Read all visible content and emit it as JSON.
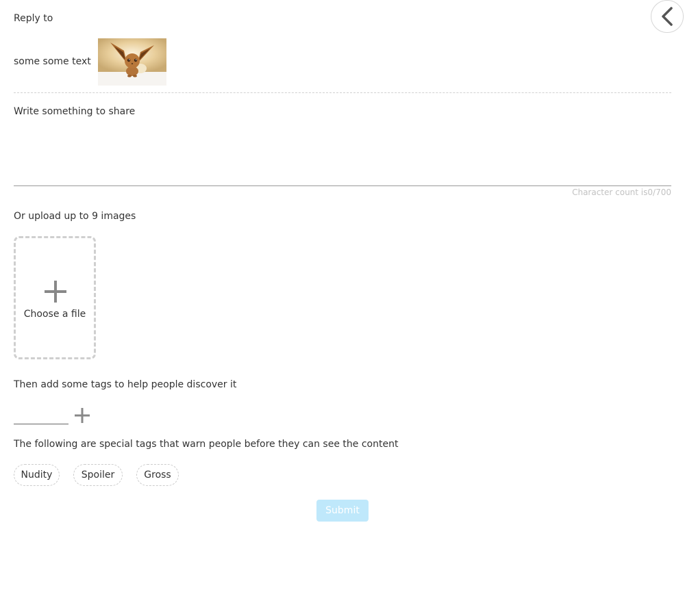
{
  "header": {
    "back_icon": "chevron-left-icon"
  },
  "reply": {
    "label": "Reply to",
    "text": "some some text",
    "thumbnail": "eevee-thumbnail"
  },
  "compose": {
    "label": "Write something to share",
    "value": "",
    "char_count_label": "Character count is",
    "char_count_value": "0/700"
  },
  "upload": {
    "label": "Or upload up to 9 images",
    "choose_label": "Choose a file",
    "plus_icon": "plus-icon"
  },
  "tags": {
    "label": "Then add some tags to help people discover it",
    "input_value": "",
    "add_icon": "plus-icon"
  },
  "special_tags": {
    "label": "The following are special tags that warn people before they can see the content",
    "items": [
      {
        "label": "Nudity"
      },
      {
        "label": "Spoiler"
      },
      {
        "label": "Gross"
      }
    ]
  },
  "submit": {
    "label": "Submit",
    "color": "#bfe8fb"
  }
}
